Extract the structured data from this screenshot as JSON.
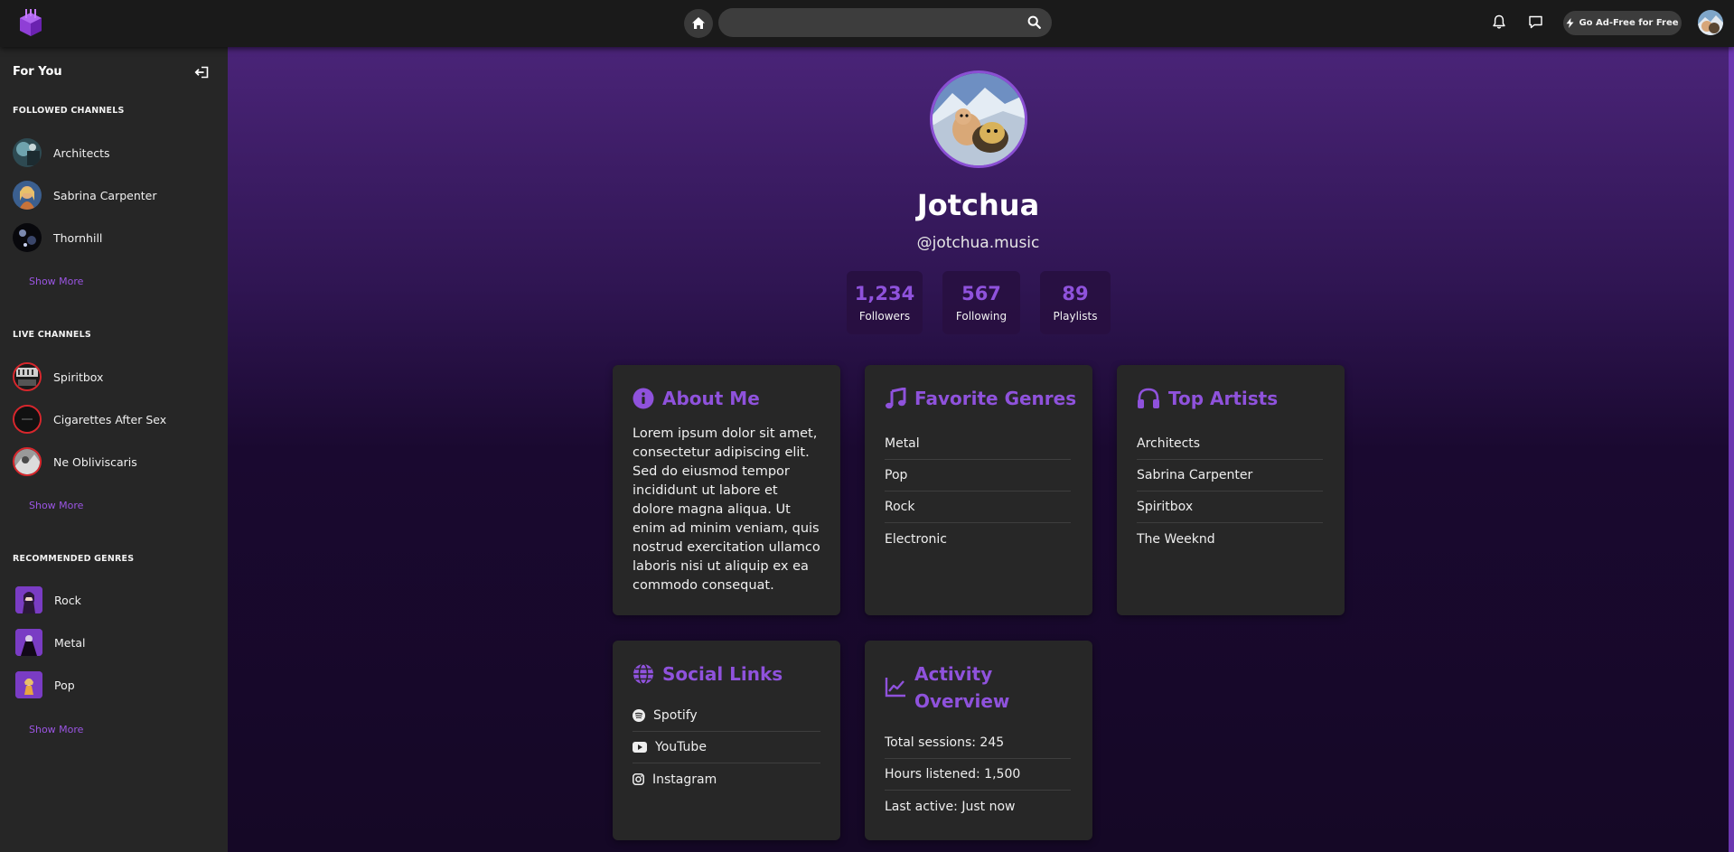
{
  "header": {
    "search": {
      "value": "",
      "placeholder": ""
    },
    "ad_free_label": "Go Ad-Free for Free",
    "accent": "#8f52dc"
  },
  "sidebar": {
    "title": "For You",
    "sections": {
      "followed": {
        "title": "FOLLOWED CHANNELS",
        "items": [
          {
            "label": "Architects"
          },
          {
            "label": "Sabrina Carpenter"
          },
          {
            "label": "Thornhill"
          }
        ],
        "more": "Show More"
      },
      "live": {
        "title": "LIVE CHANNELS",
        "items": [
          {
            "label": "Spiritbox"
          },
          {
            "label": "Cigarettes After Sex"
          },
          {
            "label": "Ne Obliviscaris"
          }
        ],
        "more": "Show More"
      },
      "genres": {
        "title": "RECOMMENDED GENRES",
        "items": [
          {
            "label": "Rock"
          },
          {
            "label": "Metal"
          },
          {
            "label": "Pop"
          }
        ],
        "more": "Show More"
      }
    }
  },
  "profile": {
    "name": "Jotchua",
    "handle": "@jotchua.music",
    "stats": [
      {
        "value": "1,234",
        "label": "Followers"
      },
      {
        "value": "567",
        "label": "Following"
      },
      {
        "value": "89",
        "label": "Playlists"
      }
    ]
  },
  "cards": {
    "about": {
      "title": "About Me",
      "text": "Lorem ipsum dolor sit amet, consectetur adipiscing elit. Sed do eiusmod tempor incididunt ut labore et dolore magna aliqua. Ut enim ad minim veniam, quis nostrud exercitation ullamco laboris nisi ut aliquip ex ea commodo consequat."
    },
    "genres": {
      "title": "Favorite Genres",
      "items": [
        "Metal",
        "Pop",
        "Rock",
        "Electronic"
      ]
    },
    "artists": {
      "title": "Top Artists",
      "items": [
        "Architects",
        "Sabrina Carpenter",
        "Spiritbox",
        "The Weeknd"
      ]
    },
    "social": {
      "title": "Social Links",
      "items": [
        "Spotify",
        "YouTube",
        "Instagram"
      ]
    },
    "activity": {
      "title_line1": "Activity",
      "title_line2": "Overview",
      "items": [
        "Total sessions: 245",
        "Hours listened: 1,500",
        "Last active: Just now"
      ]
    }
  }
}
